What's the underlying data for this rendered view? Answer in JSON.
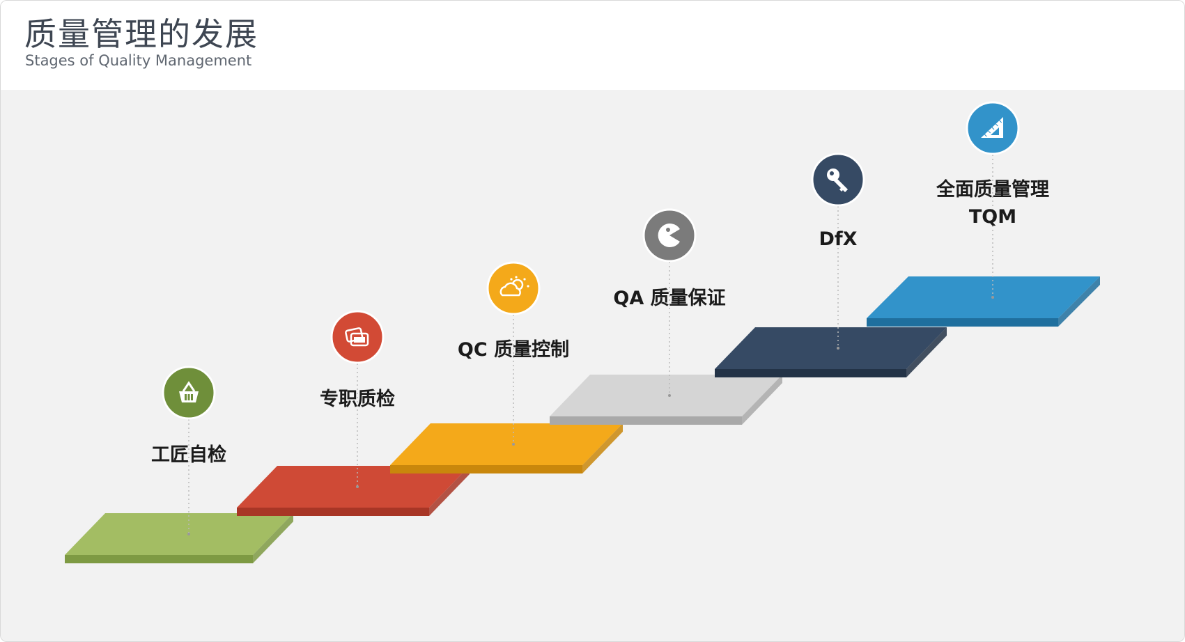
{
  "header": {
    "title": "质量管理的发展",
    "subtitle": "Stages of Quality Management"
  },
  "stages": [
    {
      "label_lines": [
        "工匠自检"
      ],
      "color": "#a3bd63",
      "side_color": "#7e9a43",
      "icon": "basket-icon",
      "icon_bg": "#6f8f3a"
    },
    {
      "label_lines": [
        "专职质检"
      ],
      "color": "#cf4a36",
      "side_color": "#a83626",
      "icon": "cards-icon",
      "icon_bg": "#d24a35"
    },
    {
      "label_lines": [
        "QC 质量控制"
      ],
      "color": "#f4a91a",
      "side_color": "#c9870c",
      "icon": "cloud-sun-icon",
      "icon_bg": "#f4a91a"
    },
    {
      "label_lines": [
        "QA 质量保证"
      ],
      "color": "#d5d5d5",
      "side_color": "#a9a9a9",
      "icon": "pacman-icon",
      "icon_bg": "#7b7b7b"
    },
    {
      "label_lines": [
        "DfX"
      ],
      "color": "#364a64",
      "side_color": "#233347",
      "icon": "key-icon",
      "icon_bg": "#364a64"
    },
    {
      "label_lines": [
        "全面质量管理",
        "TQM"
      ],
      "color": "#3293ca",
      "side_color": "#1f6f9e",
      "icon": "triangle-ruler-icon",
      "icon_bg": "#3293ca"
    }
  ]
}
